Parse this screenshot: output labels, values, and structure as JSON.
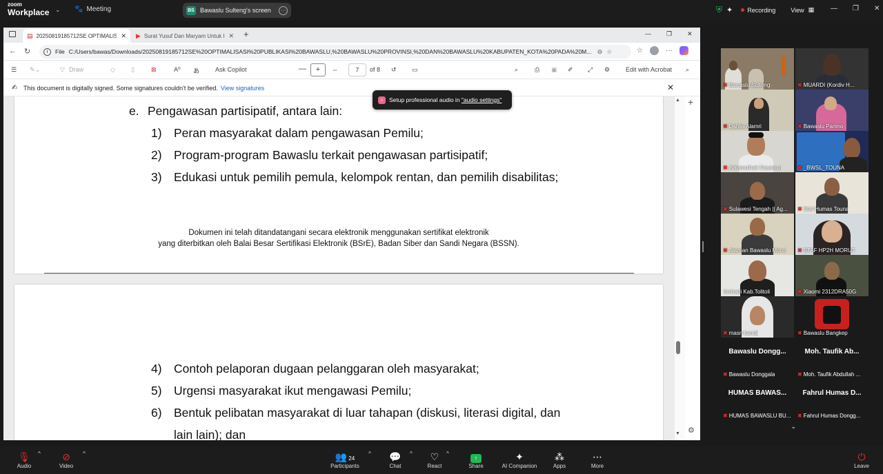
{
  "zoom": {
    "logo_line1": "zoom",
    "logo_line2": "Workplace",
    "meeting_label": "Meeting",
    "share_badge": "BS",
    "share_title": "Bawaslu Sulteng's screen",
    "recording_label": "Recording",
    "view_label": "View",
    "toast_prefix": "Setup professional audio in ",
    "toast_link": "\"audio settings\"",
    "bottom": {
      "audio": "Audio",
      "video": "Video",
      "participants": "Participants",
      "participants_count": "24",
      "chat": "Chat",
      "react": "React",
      "share": "Share",
      "ai": "AI Companion",
      "apps": "Apps",
      "more": "More",
      "leave": "Leave"
    }
  },
  "browser": {
    "tab1": "20250819185712SE OPTIMALISASI PUBLIKASI",
    "tab2": "Surat Yusuf Dan Maryam Untuk Ibu Hamil",
    "file_label": "File",
    "url": "C:/Users/bawas/Downloads/20250819185712SE%20OPTIMALISASI%20PUBLIKASI%20BAWASLU,%20BAWASLU%20PROVINSI,%20DAN%20BAWASLU%20KABUPATEN_KOTA%20PADA%20M..."
  },
  "pdf_toolbar": {
    "draw": "Draw",
    "ask_copilot": "Ask Copilot",
    "page_current": "7",
    "page_total": "of 8",
    "edit_acrobat": "Edit with Acrobat"
  },
  "signature_bar": {
    "message": "This document is digitally signed. Some signatures couldn't be verified.",
    "link": "View signatures"
  },
  "document": {
    "page7": {
      "item_e": "Pengawasan partisipatif, antara lain:",
      "item_e_marker": "e.",
      "sub": [
        {
          "n": "1)",
          "t": "Peran masyarakat dalam pengawasan Pemilu;"
        },
        {
          "n": "2)",
          "t": "Program-program Bawaslu terkait pengawasan partisipatif;"
        },
        {
          "n": "3)",
          "t": "Edukasi untuk pemilih pemula, kelompok rentan, dan pemilih disabilitas;"
        }
      ],
      "footer_line1": "Dokumen ini telah ditandatangani secara elektronik menggunakan sertifikat elektronik",
      "footer_line2": "yang diterbitkan oleh Balai Besar Sertifikasi Elektronik (BSrE), Badan Siber dan Sandi Negara (BSSN)."
    },
    "page8": {
      "sub": [
        {
          "n": "4)",
          "t": "Contoh pelaporan dugaan pelanggaran oleh masyarakat;"
        },
        {
          "n": "5)",
          "t": "Urgensi masyarakat ikut mengawasi Pemilu;"
        },
        {
          "n": "6)",
          "t": "Bentuk pelibatan masyarakat di luar tahapan (diskusi, literasi digital, dan"
        }
      ],
      "item6_cont": "lain lain); dan"
    }
  },
  "participants": [
    {
      "name": "Bawaslu Sulteng"
    },
    {
      "name": "MUARDI (Kordiv H..."
    },
    {
      "name": "Dahlia Alamri"
    },
    {
      "name": "Bawaslu Parimo"
    },
    {
      "name": "Arkamulhak Dayanun"
    },
    {
      "name": "_BWSL_TOUNA"
    },
    {
      "name": "Sulawesi Tengah || Ag..."
    },
    {
      "name": "Staf Humas Touna"
    },
    {
      "name": "Jasman Bawaslu Morut"
    },
    {
      "name": "STAF HP2H MORUT"
    },
    {
      "name": "Amhadi Kab.Tolitoli"
    },
    {
      "name": "Xiaomi 2312DRA50G"
    },
    {
      "name": "masri kandji"
    },
    {
      "name": "Bawaslu Bangkep"
    }
  ],
  "name_tiles": [
    {
      "big": "Bawaslu Dongg...",
      "name": "Bawaslu Donggala"
    },
    {
      "big": "Moh. Taufik Ab...",
      "name": "Moh. Taufik Abdullah ..."
    },
    {
      "big": "HUMAS BAWAS...",
      "name": "HUMAS BAWASLU BU..."
    },
    {
      "big": "Fahrul Humas D...",
      "name": "Fahrul Humas Dongg..."
    }
  ],
  "colors": {
    "active_speaker": "#2dd36f",
    "mic_muted": "#e0302a",
    "link": "#1a64c8"
  }
}
